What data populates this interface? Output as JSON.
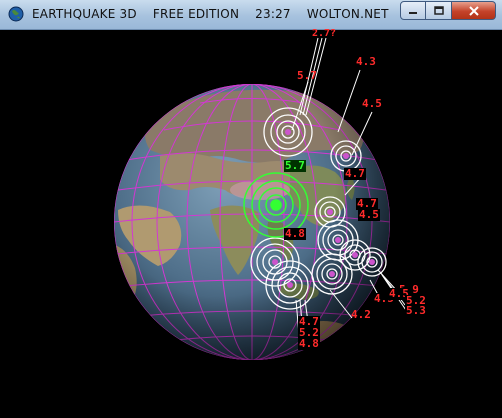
{
  "window": {
    "title": "EARTHQUAKE 3D    FREE EDITION    23:27    WOLTON.NET    Ve..."
  },
  "icons": {
    "app": "earth-icon",
    "minimize": "minimize-icon",
    "maximize": "maximize-icon",
    "close": "close-icon"
  },
  "colors": {
    "background": "#000000",
    "grid": "#d238d2",
    "quake_rings": "#ffffff",
    "quake_center": "#cc55cc",
    "recent_quake": "#33ff33",
    "magnitude_label": "#ff2b2b"
  },
  "quake_labels": {
    "m_top": "2.7?",
    "m1": "5.7",
    "m2": "4.3",
    "m3": "4.5",
    "m_green": "5.7",
    "m4": "4.7",
    "m5": "4.7",
    "m6": "4.5",
    "m7": "4.8",
    "m8": "4.5",
    "m9": "5.9",
    "m10": "4.5",
    "m11": "5.2",
    "m12": "5.3",
    "m13": "4.2",
    "m14": "4.7",
    "m15": "5.2",
    "m16": "4.8"
  }
}
